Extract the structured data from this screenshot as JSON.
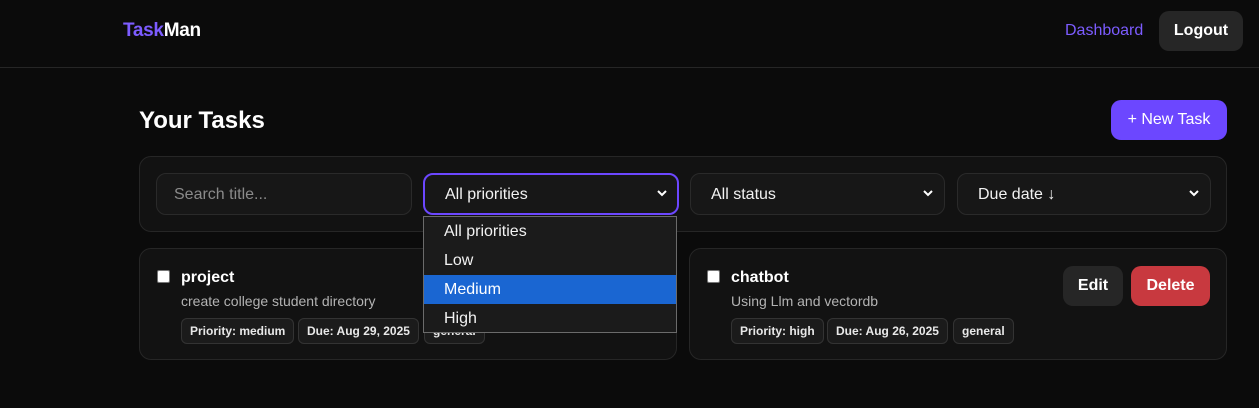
{
  "nav": {
    "brand_part1": "Task",
    "brand_part2": "Man",
    "dashboard_link": "Dashboard",
    "logout_label": "Logout"
  },
  "header": {
    "title": "Your Tasks",
    "new_task_label": "+ New Task"
  },
  "filters": {
    "search_placeholder": "Search title...",
    "priority_value": "All priorities",
    "status_value": "All status",
    "sort_value": "Due date ↓",
    "priority_options": [
      "All priorities",
      "Low",
      "Medium",
      "High"
    ],
    "priority_highlighted": "Medium"
  },
  "tasks": [
    {
      "title": "project",
      "description": "create college student directory",
      "priority_tag": "Priority: medium",
      "due_tag": "Due: Aug 29, 2025",
      "category_tag": "general"
    },
    {
      "title": "chatbot",
      "description": "Using Llm and vectordb",
      "priority_tag": "Priority: high",
      "due_tag": "Due: Aug 26, 2025",
      "category_tag": "general",
      "edit_label": "Edit",
      "delete_label": "Delete"
    }
  ],
  "colors": {
    "accent": "#6c47ff",
    "danger": "#c8393f",
    "highlight": "#1a66d2"
  }
}
